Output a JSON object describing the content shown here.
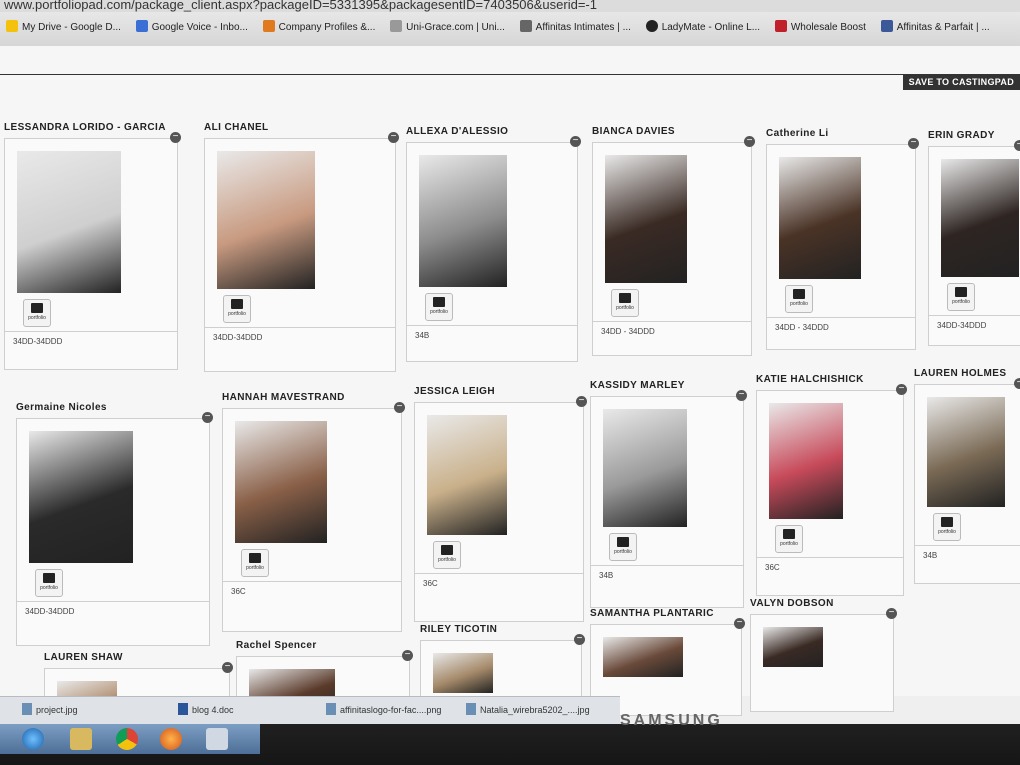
{
  "browser": {
    "url": "www.portfoliopad.com/package_client.aspx?packageID=5331395&packagesentID=7403506&userid=-1",
    "bookmarks": [
      {
        "label": "My Drive - Google D...",
        "color": "#f4c20d"
      },
      {
        "label": "Google Voice - Inbo...",
        "color": "#3b6fd6"
      },
      {
        "label": "Company Profiles &...",
        "color": "#e07a1f"
      },
      {
        "label": "Uni-Grace.com | Uni...",
        "color": "#999999"
      },
      {
        "label": "Affinitas Intimates | ...",
        "color": "#666666"
      },
      {
        "label": "LadyMate - Online L...",
        "color": "#222222"
      },
      {
        "label": "Wholesale Boost",
        "color": "#c0202a"
      },
      {
        "label": "Affinitas & Parfait | ...",
        "color": "#3b5998"
      }
    ]
  },
  "page": {
    "save_button": "SAVE TO CASTINGPAD",
    "portfolio_label": "portfolio",
    "models": [
      {
        "name": "LESSANDRA LORIDO - GARCIA",
        "size": "34DD-34DDD",
        "photo_color": "#cfcfcf"
      },
      {
        "name": "ALI CHANEL",
        "size": "34DD-34DDD",
        "photo_color": "#c89a80"
      },
      {
        "name": "ALLEXA D'ALESSIO",
        "size": "34B",
        "photo_color": "#8c8c8c"
      },
      {
        "name": "BIANCA DAVIES",
        "size": "34DD - 34DDD",
        "photo_color": "#3a2a24"
      },
      {
        "name": "Catherine Li",
        "size": "34DD - 34DDD",
        "photo_color": "#4a3326"
      },
      {
        "name": "ERIN GRADY",
        "size": "34DD-34DDD",
        "photo_color": "#2e2522"
      },
      {
        "name": "Germaine Nicoles",
        "size": "34DD-34DDD",
        "photo_color": "#2a2a2a"
      },
      {
        "name": "HANNAH MAVESTRAND",
        "size": "36C",
        "photo_color": "#8a6048"
      },
      {
        "name": "JESSICA LEIGH",
        "size": "36C",
        "photo_color": "#c9b08a"
      },
      {
        "name": "KASSIDY MARLEY",
        "size": "34B",
        "photo_color": "#9a9a9a"
      },
      {
        "name": "KATIE HALCHISHICK",
        "size": "36C",
        "photo_color": "#c74a5a"
      },
      {
        "name": "LAUREN HOLMES",
        "size": "34B",
        "photo_color": "#7a6a55"
      },
      {
        "name": "LAUREN SHAW",
        "size": "",
        "photo_color": "#b89a80"
      },
      {
        "name": "Rachel Spencer",
        "size": "",
        "photo_color": "#5a3a2a"
      },
      {
        "name": "RILEY TICOTIN",
        "size": "",
        "photo_color": "#a58a6a"
      },
      {
        "name": "SAMANTHA PLANTARIC",
        "size": "",
        "photo_color": "#6a4a3a"
      },
      {
        "name": "VALYN DOBSON",
        "size": "",
        "photo_color": "#3a2a24"
      }
    ]
  },
  "downloads": [
    {
      "label": "project.jpg"
    },
    {
      "label": "blog 4.doc"
    },
    {
      "label": "affinitaslogo-for-fac....png"
    },
    {
      "label": "Natalia_wirebra5202_....jpg"
    }
  ],
  "monitor_brand": "SAMSUNG"
}
